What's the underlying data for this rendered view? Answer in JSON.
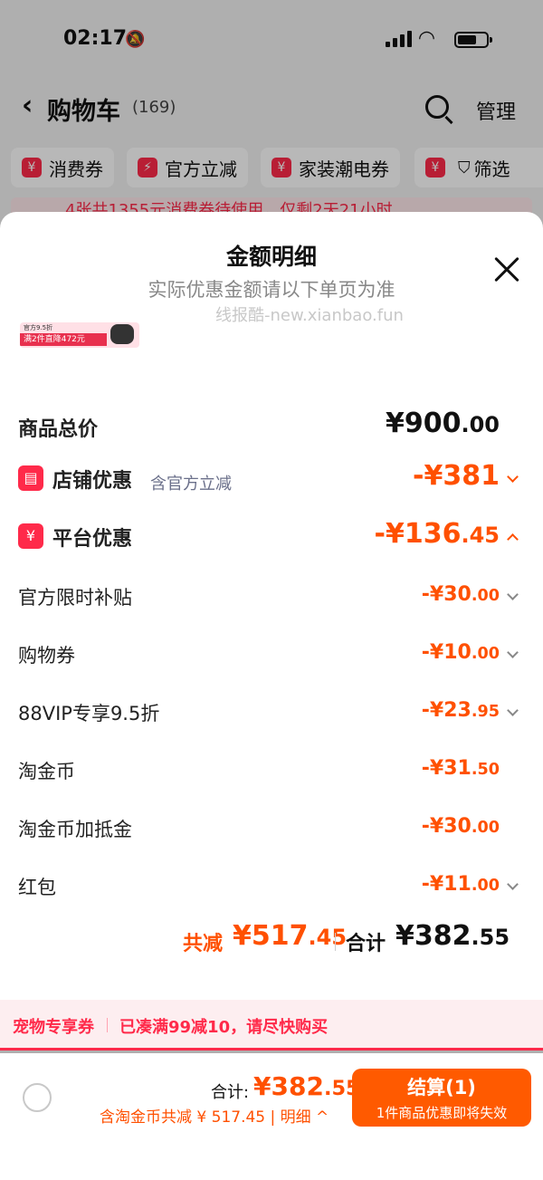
{
  "status_bar": {
    "time": "02:17"
  },
  "nav": {
    "back_icon": "chevron-left-icon",
    "title": "购物车",
    "count": "(169)",
    "manage": "管理"
  },
  "chips": [
    {
      "label": "消费券",
      "icon": "yen-ticket-icon"
    },
    {
      "label": "官方立减",
      "icon": "lightning-icon"
    },
    {
      "label": "家装潮电券",
      "icon": "yen-ticket-icon"
    },
    {
      "label": "筛选",
      "icon": "filter-icon"
    }
  ],
  "promo_bar": {
    "text": "4张共1355元消费券待使用，仅剩2天21小时"
  },
  "sheet": {
    "title": "金额明细",
    "subtitle": "实际优惠金额请以下单页为准",
    "watermark": "线报酷-new.xianbao.fun",
    "thumb_line1": "官方9.5折",
    "thumb_line2": "满2件直降472元",
    "total": {
      "label": "商品总价",
      "int": "¥900",
      "dec": ".00"
    },
    "store_discount": {
      "label": "店铺优惠",
      "note": "含官方立减",
      "int": "-¥381",
      "dec": ""
    },
    "platform_discount": {
      "label": "平台优惠",
      "int": "-¥136",
      "dec": ".45"
    },
    "items": [
      {
        "label": "官方限时补贴",
        "int": "-¥30",
        "dec": ".00",
        "chevron": true
      },
      {
        "label": "购物券",
        "int": "-¥10",
        "dec": ".00",
        "chevron": true
      },
      {
        "label": "88VIP专享9.5折",
        "int": "-¥23",
        "dec": ".95",
        "chevron": true
      },
      {
        "label": "淘金币",
        "int": "-¥31",
        "dec": ".50",
        "chevron": false
      },
      {
        "label": "淘金币加抵金",
        "int": "-¥30",
        "dec": ".00",
        "chevron": false
      },
      {
        "label": "红包",
        "int": "-¥11",
        "dec": ".00",
        "chevron": true
      }
    ],
    "summary": {
      "save_label": "共减",
      "save_int": "¥517",
      "save_dec": ".45",
      "total_label": "合计",
      "total_int": "¥382",
      "total_dec": ".55"
    }
  },
  "pet_bar": {
    "tag": "宠物专享券",
    "message": "已凑满99减10，请尽快购买"
  },
  "bottom": {
    "total_label": "合计:",
    "total_int": "¥382",
    "total_dec": ".55",
    "save_text": "含淘金币共减 ¥ 517.45 | 明细",
    "checkout_label": "结算(1)",
    "checkout_sub": "1件商品优惠即将失效"
  },
  "colors": {
    "accent": "#ff5000",
    "brand_red": "#ff2a4a",
    "checkout_bg": "#ff5a00"
  }
}
